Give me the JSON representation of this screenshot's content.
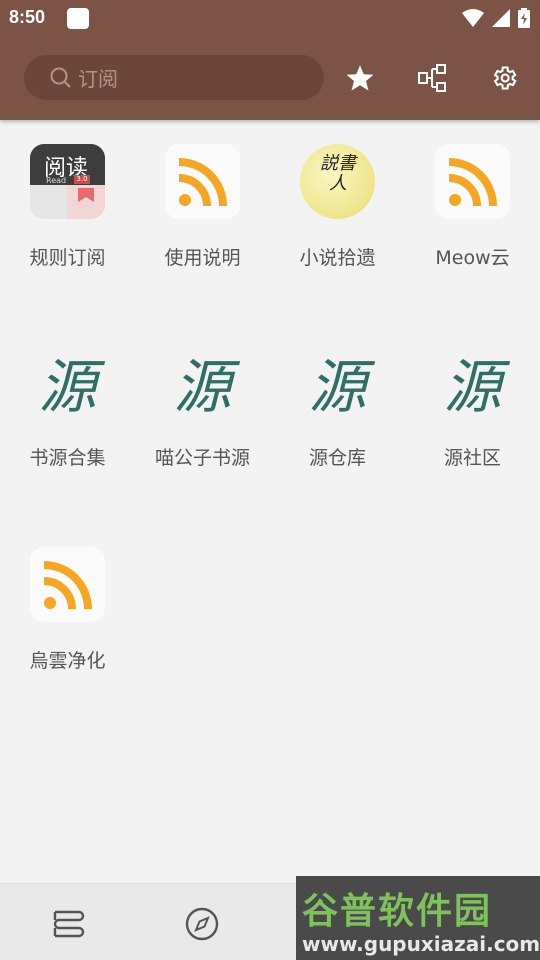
{
  "status_bar": {
    "time": "8:50"
  },
  "search": {
    "placeholder": "订阅"
  },
  "colors": {
    "appbar": "#7b5445",
    "rss_orange": "#f5a623",
    "background": "#f3f3f3"
  },
  "subscriptions": [
    {
      "label": "规则订阅",
      "icon": "legado-read-app-icon",
      "icon_text": "阅读",
      "icon_subtext": "Read",
      "icon_badge": "3.0"
    },
    {
      "label": "使用说明",
      "icon": "rss-icon"
    },
    {
      "label": "小说拾遗",
      "icon": "shuoshuren-icon",
      "icon_text": "説書人"
    },
    {
      "label": "Meow云",
      "icon": "rss-icon"
    },
    {
      "label": "书源合集",
      "icon": "yuan-icon",
      "icon_text": "源"
    },
    {
      "label": "喵公子书源",
      "icon": "yuan-icon",
      "icon_text": "源"
    },
    {
      "label": "源仓库",
      "icon": "yuan-icon",
      "icon_text": "源"
    },
    {
      "label": "源社区",
      "icon": "yuan-icon",
      "icon_text": "源"
    },
    {
      "label": "烏雲净化",
      "icon": "rss-icon"
    }
  ],
  "bottom_nav": [
    {
      "icon": "bookshelf-icon"
    },
    {
      "icon": "compass-icon"
    }
  ],
  "watermark": {
    "title": "谷普软件园",
    "url": "www.gupuxiazai.com"
  }
}
